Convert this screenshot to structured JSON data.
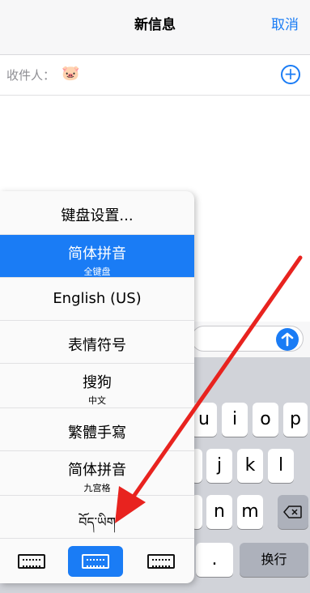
{
  "navbar": {
    "title": "新信息",
    "cancel_label": "取消"
  },
  "recipient": {
    "label": "收件人：",
    "emoji": "🐷"
  },
  "keyboard": {
    "row2": [
      "u",
      "i",
      "o",
      "p"
    ],
    "row3": [
      "j",
      "k",
      "l"
    ],
    "row4": [
      "n",
      "m"
    ],
    "dot_label": ".",
    "return_label": "换行"
  },
  "ime_menu": {
    "items": [
      {
        "main": "键盘设置...",
        "sub": ""
      },
      {
        "main": "简体拼音",
        "sub": "全键盘"
      },
      {
        "main": "English (US)",
        "sub": ""
      },
      {
        "main": "表情符号",
        "sub": ""
      },
      {
        "main": "搜狗",
        "sub": "中文"
      },
      {
        "main": "繁體手寫",
        "sub": ""
      },
      {
        "main": "简体拼音",
        "sub": "九宫格"
      },
      {
        "main": "བོད་ཡིག",
        "sub": ""
      }
    ],
    "selected_index": 1
  },
  "colors": {
    "accent": "#1a7cf5",
    "arrow": "#e8231f"
  },
  "icons": [
    "plus-circle-icon",
    "send-arrow-icon",
    "delete-backspace-icon",
    "keyboard-left-icon",
    "keyboard-full-icon",
    "keyboard-right-icon"
  ]
}
